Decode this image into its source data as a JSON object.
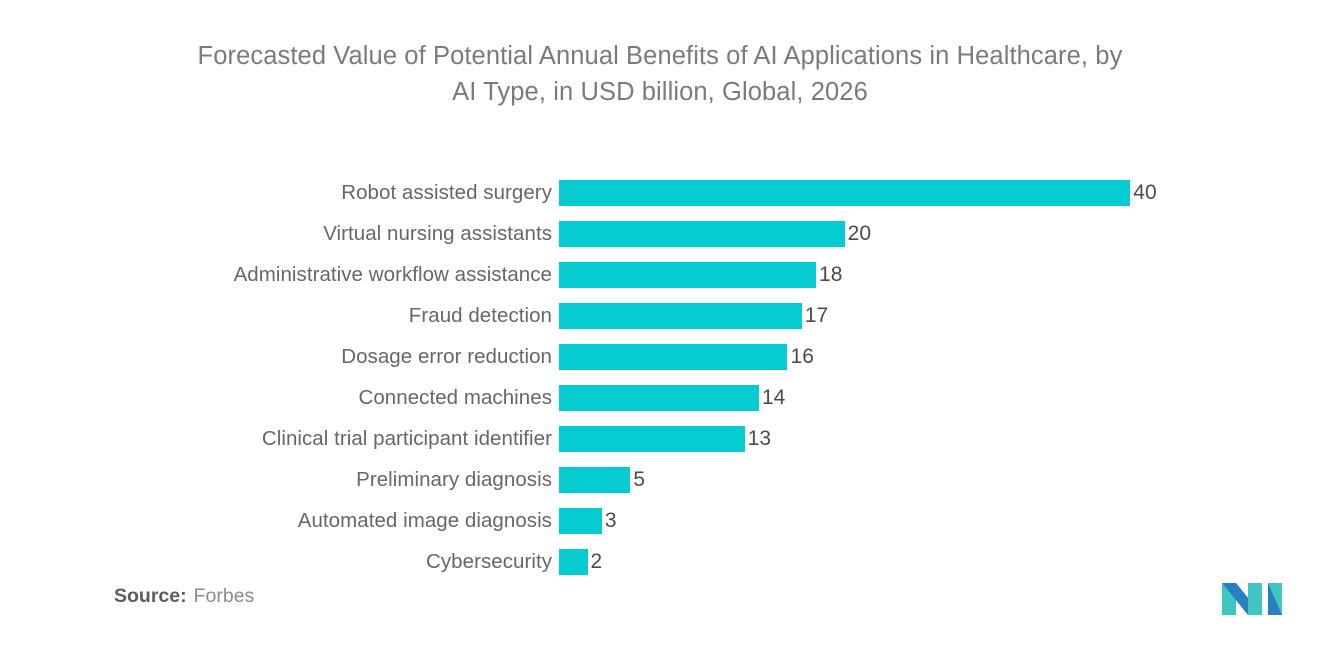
{
  "chart_data": {
    "type": "bar",
    "orientation": "horizontal",
    "title": "Forecasted Value of Potential Annual Benefits of AI Applications in Healthcare, by AI Type, in USD billion, Global, 2026",
    "title_line_1": "Forecasted Value of Potential Annual Benefits of AI Applications in Healthcare, by AI",
    "title_line_2": "Type, in USD billion, Global, 2026",
    "xlabel": "",
    "ylabel": "",
    "xlim": [
      0,
      40
    ],
    "grid": false,
    "legend": false,
    "bar_color": "#06CBD0",
    "categories": [
      "Robot assisted surgery",
      "Virtual nursing assistants",
      "Administrative workflow assistance",
      "Fraud detection",
      "Dosage error reduction",
      "Connected machines",
      "Clinical trial participant identifier",
      "Preliminary diagnosis",
      "Automated image diagnosis",
      "Cybersecurity"
    ],
    "values": [
      40,
      20,
      18,
      17,
      16,
      14,
      13,
      5,
      3,
      2
    ],
    "data_labels": [
      "40",
      "20",
      "18",
      "17",
      "16",
      "14",
      "13",
      "5",
      "3",
      "2"
    ],
    "units": "USD billion",
    "source": "Forbes"
  },
  "footer": {
    "source_label": "Source:",
    "source_value": "Forbes",
    "logo_name": "mordor-intelligence-logo"
  }
}
